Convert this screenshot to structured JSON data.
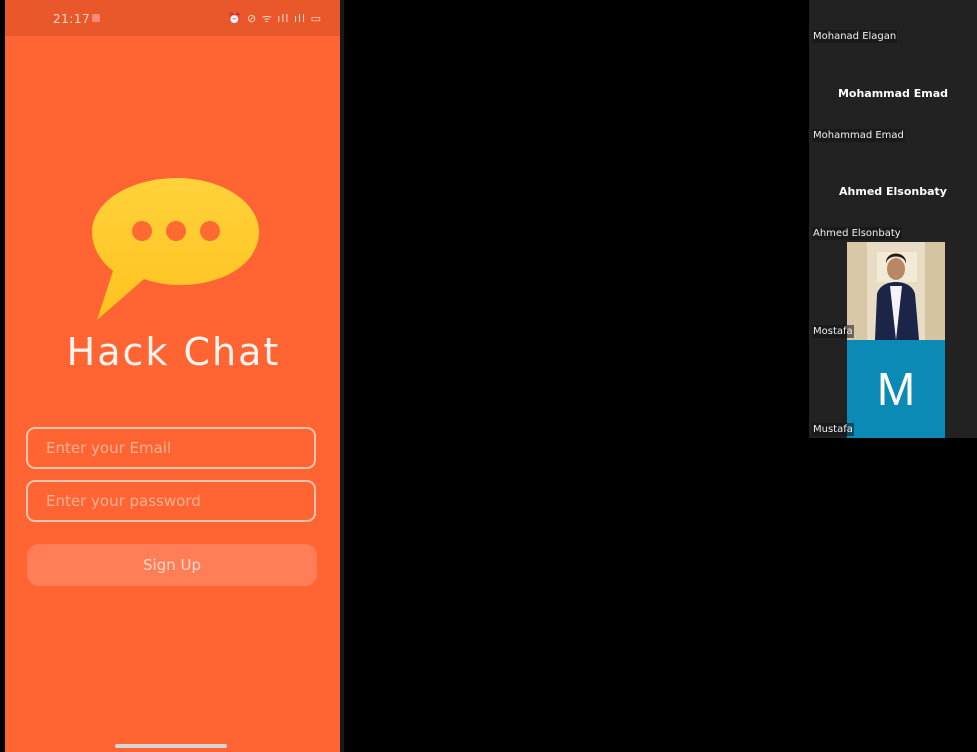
{
  "phone": {
    "status_time": "21:17",
    "status_icons": "⏰ ⊘ ᯤ ıll ıll ▭",
    "app_title": "Hack Chat",
    "email_placeholder": "Enter your Email",
    "password_placeholder": "Enter your password",
    "signup_label": "Sign Up",
    "colors": {
      "background": "#ff6432",
      "logo": "#ffcc33"
    }
  },
  "participants": [
    {
      "label": "Mohanad Elagan"
    },
    {
      "center_name": "Mohammad Emad",
      "label": "Mohammad Emad"
    },
    {
      "center_name": "Ahmed Elsonbaty",
      "label": "Ahmed Elsonbaty"
    },
    {
      "label": "Mostafa",
      "video": "photo"
    },
    {
      "label": "Mustafa",
      "avatar_letter": "M",
      "avatar_color": "#0a8ab4"
    }
  ]
}
